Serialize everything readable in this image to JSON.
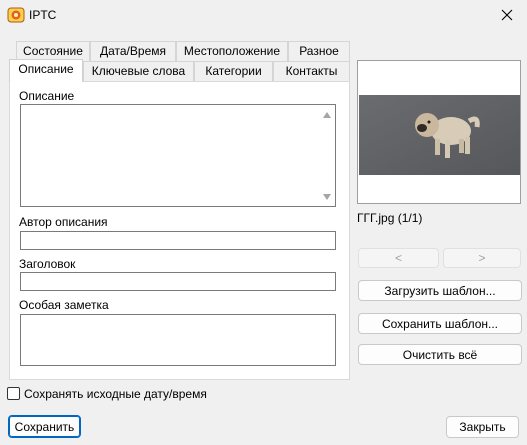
{
  "window": {
    "title": "IPTC",
    "icon": "iptc-app-icon",
    "close_icon": "close-icon"
  },
  "tabs_row1": [
    {
      "label": "Состояние"
    },
    {
      "label": "Дата/Время"
    },
    {
      "label": "Местоположение"
    },
    {
      "label": "Разное"
    }
  ],
  "tabs_row2": [
    {
      "label": "Описание",
      "active": true
    },
    {
      "label": "Ключевые слова"
    },
    {
      "label": "Категории"
    },
    {
      "label": "Контакты"
    }
  ],
  "form": {
    "description_label": "Описание",
    "description_value": "",
    "author_label": "Автор описания",
    "author_value": "",
    "headline_label": "Заголовок",
    "headline_value": "",
    "special_note_label": "Особая заметка",
    "special_note_value": ""
  },
  "preview": {
    "filename": "ГГГ.jpg (1/1)",
    "prev_label": "<",
    "next_label": ">"
  },
  "actions": {
    "load_template": "Загрузить шаблон...",
    "save_template": "Сохранить шаблон...",
    "clear_all": "Очистить всё"
  },
  "keep_date": {
    "label": "Сохранять исходные дату/время",
    "checked": false
  },
  "footer": {
    "save": "Сохранить",
    "close": "Закрыть"
  }
}
